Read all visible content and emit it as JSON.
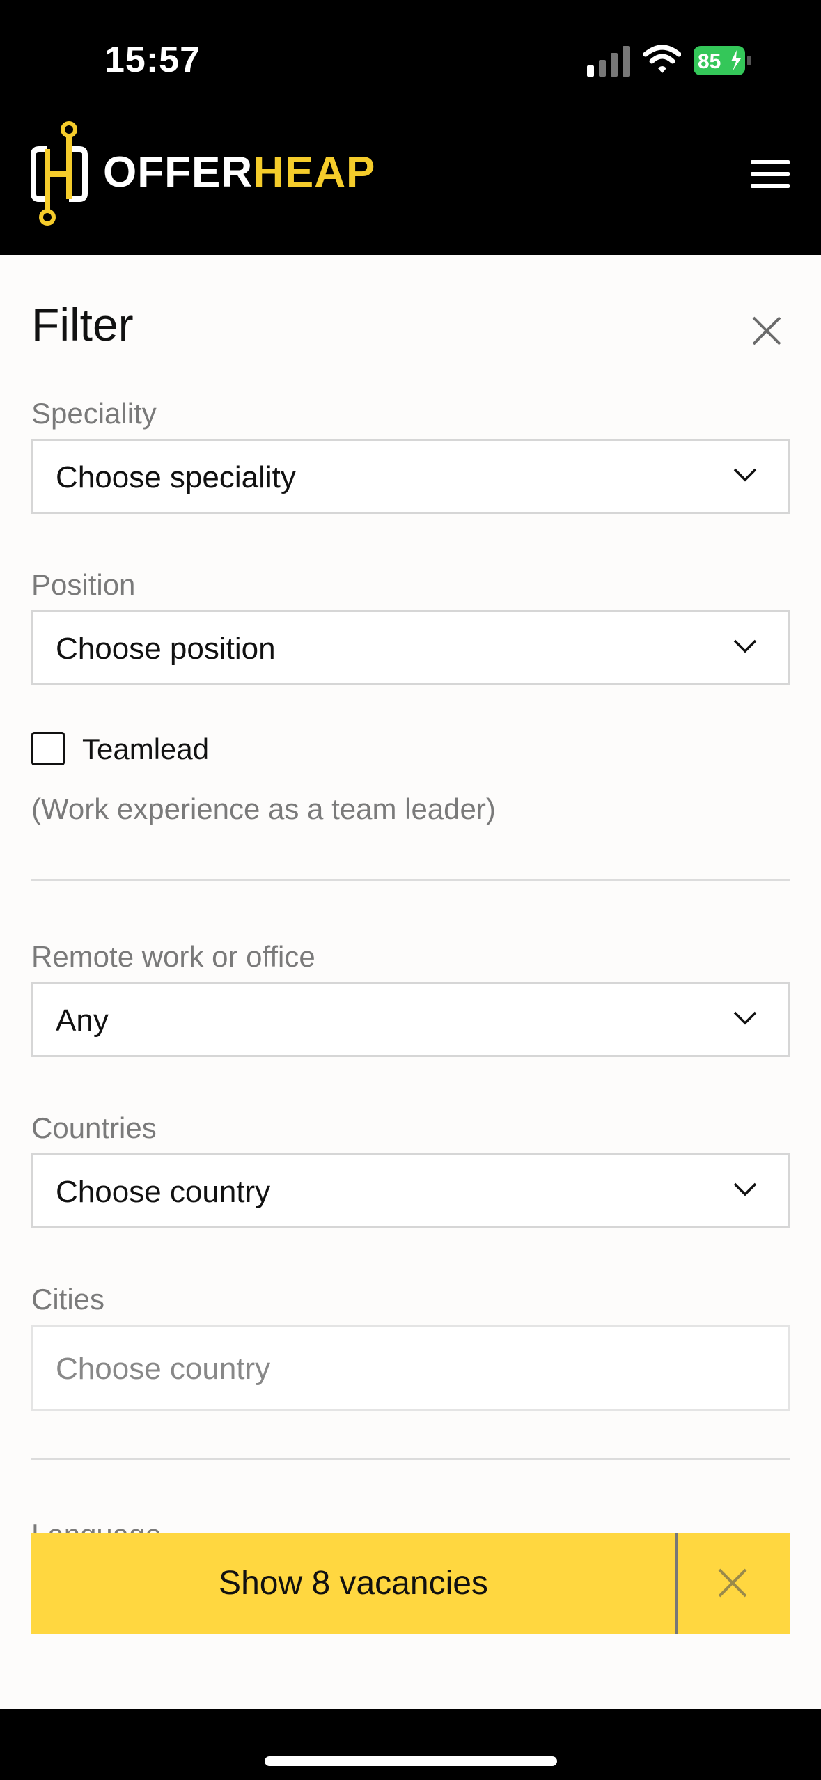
{
  "status": {
    "time": "15:57",
    "battery": "85"
  },
  "brand": {
    "name_part1": "OFFER",
    "name_part2": "HEAP"
  },
  "filter": {
    "title": "Filter",
    "speciality": {
      "label": "Speciality",
      "value": "Choose speciality"
    },
    "position": {
      "label": "Position",
      "value": "Choose position"
    },
    "teamlead": {
      "label": "Teamlead",
      "checked": false,
      "hint": "(Work experience as a team leader)"
    },
    "remote": {
      "label": "Remote work or office",
      "value": "Any"
    },
    "countries": {
      "label": "Countries",
      "value": "Choose country"
    },
    "cities": {
      "label": "Cities",
      "placeholder": "Choose country"
    },
    "language": {
      "label": "Language"
    }
  },
  "actions": {
    "show_label": "Show 8 vacancies"
  },
  "colors": {
    "accent": "#ffd740",
    "brand_yellow": "#f5cc2b",
    "battery_green": "#34c759"
  }
}
